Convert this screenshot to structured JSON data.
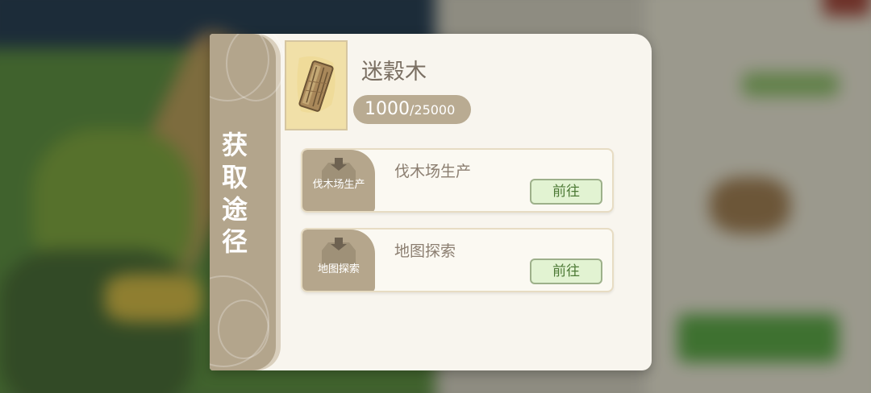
{
  "panel": {
    "side_title": "获取途径",
    "item": {
      "name": "迷穀木",
      "icon": "wood-plank-icon",
      "count_current": "1000",
      "count_separator": "/",
      "count_max": "25000"
    },
    "sources": [
      {
        "icon": "production-tray-icon",
        "icon_label": "伐木场生产",
        "title": "伐木场生产",
        "button_label": "前往"
      },
      {
        "icon": "production-tray-icon",
        "icon_label": "地图探索",
        "title": "地图探索",
        "button_label": "前往"
      }
    ]
  },
  "colors": {
    "panel_bg": "#f8f5ee",
    "side_bar": "#b3a58c",
    "go_button_bg": "#e2f3d2",
    "go_button_text": "#4d7a36"
  }
}
